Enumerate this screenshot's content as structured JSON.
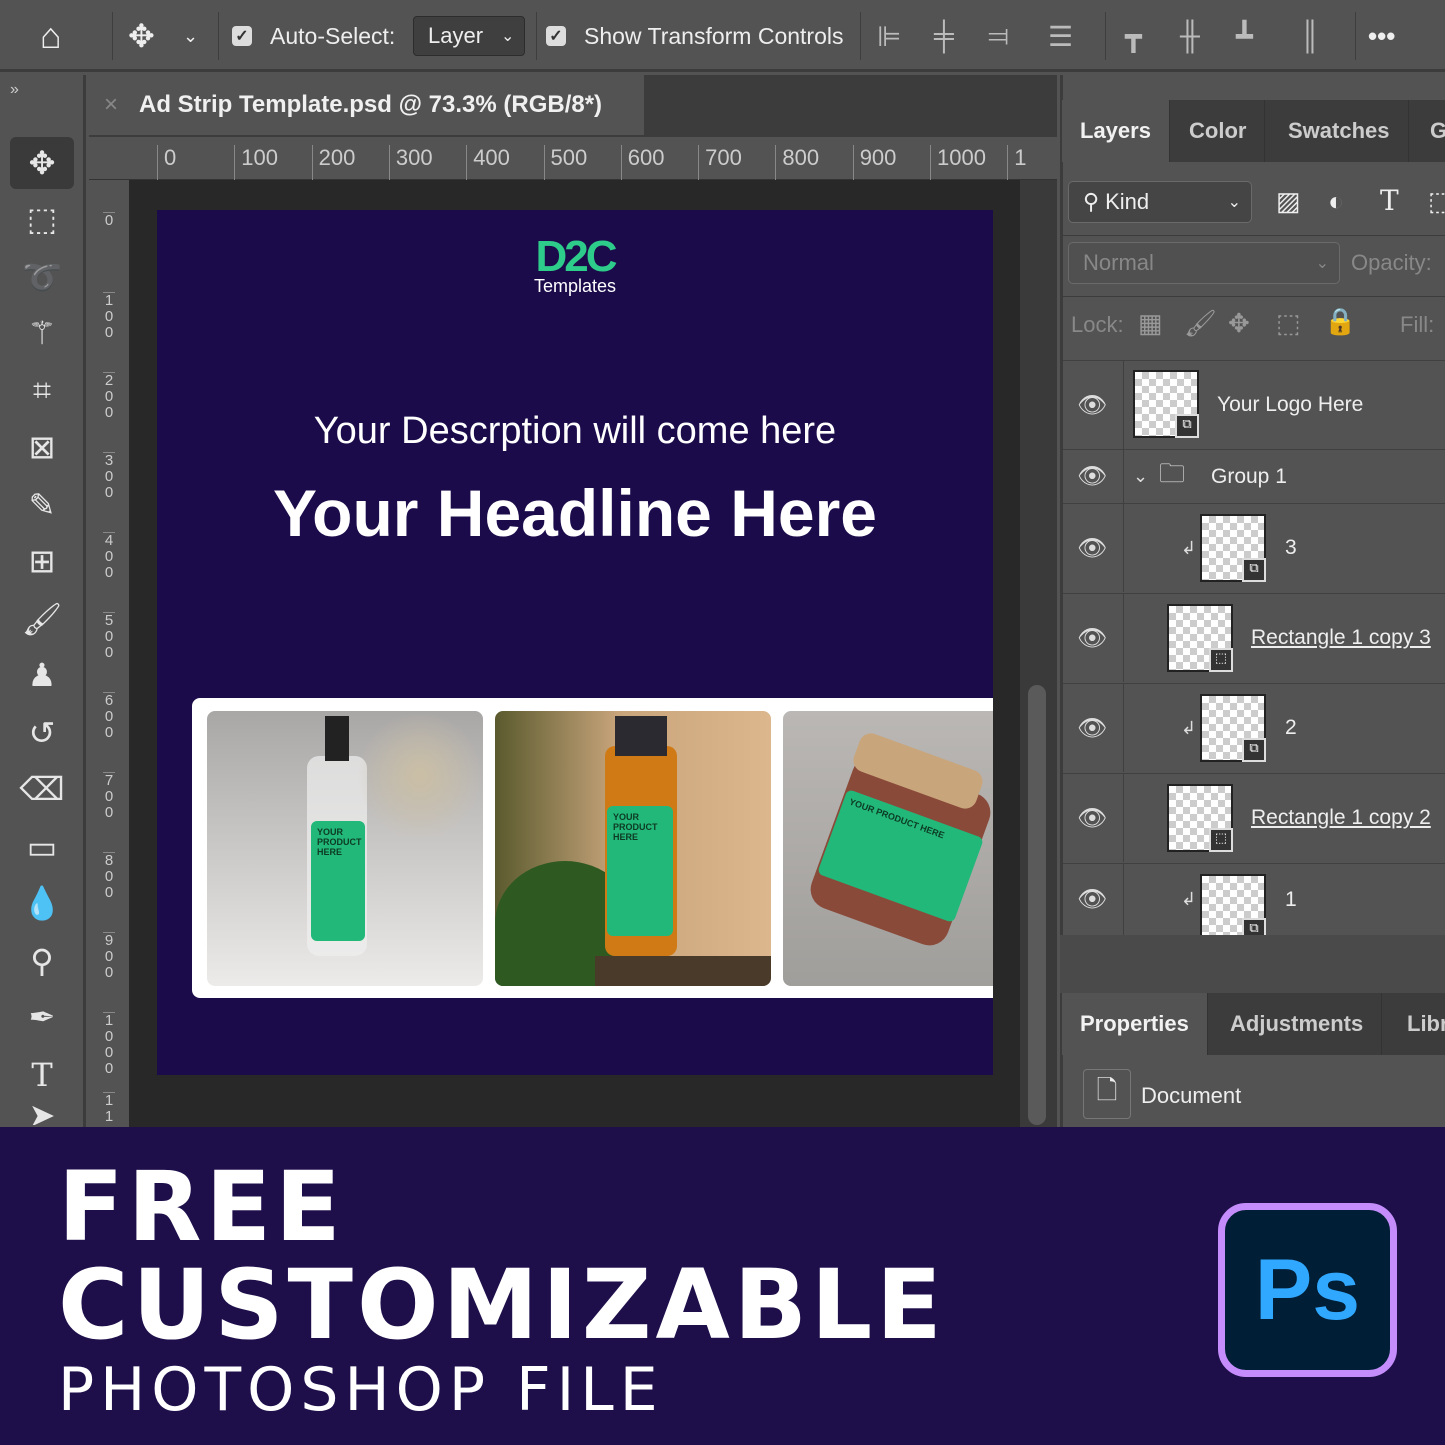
{
  "toolbar": {
    "auto_select_label": "Auto-Select:",
    "auto_select_checked": true,
    "layer_select": "Layer",
    "show_transform_label": "Show Transform Controls",
    "show_transform_checked": true,
    "more": "•••"
  },
  "document": {
    "tab_title": "Ad Strip Template.psd @ 73.3% (RGB/8*)",
    "close": "×",
    "collapse": "»"
  },
  "rulers": {
    "horizontal": [
      "0",
      "100",
      "200",
      "300",
      "400",
      "500",
      "600",
      "700",
      "800",
      "900",
      "1000",
      "1"
    ],
    "vertical": [
      "0",
      "100",
      "200",
      "300",
      "400",
      "500",
      "600",
      "700",
      "800",
      "900",
      "1000",
      "11"
    ]
  },
  "artboard": {
    "logo_mark": "D2C",
    "logo_sub": "Templates",
    "description": "Your Descrption  will come here",
    "headline": "Your Headline Here",
    "product_label": "YOUR PRODUCT HERE",
    "bg": "#1b0b4a"
  },
  "panel": {
    "tabs": [
      "Layers",
      "Color",
      "Swatches",
      "G"
    ],
    "filter_kind": "Kind",
    "blend_mode": "Normal",
    "opacity_label": "Opacity:",
    "lock_label": "Lock:",
    "fill_label": "Fill:",
    "layers": [
      {
        "name": "Your Logo Here",
        "linked": false
      },
      {
        "name": "Group 1",
        "type": "group"
      },
      {
        "name": "3",
        "clipped": true
      },
      {
        "name": "Rectangle 1 copy 3",
        "linked": true
      },
      {
        "name": "2",
        "clipped": true
      },
      {
        "name": "Rectangle 1 copy 2",
        "linked": true
      },
      {
        "name": "1",
        "clipped": true
      }
    ]
  },
  "properties": {
    "tabs": [
      "Properties",
      "Adjustments",
      "Libr"
    ],
    "item": "Document"
  },
  "banner": {
    "line1": "FREE",
    "line2": "CUSTOMIZABLE",
    "line3": "PHOTOSHOP FILE",
    "ps_logo": "Ps"
  }
}
